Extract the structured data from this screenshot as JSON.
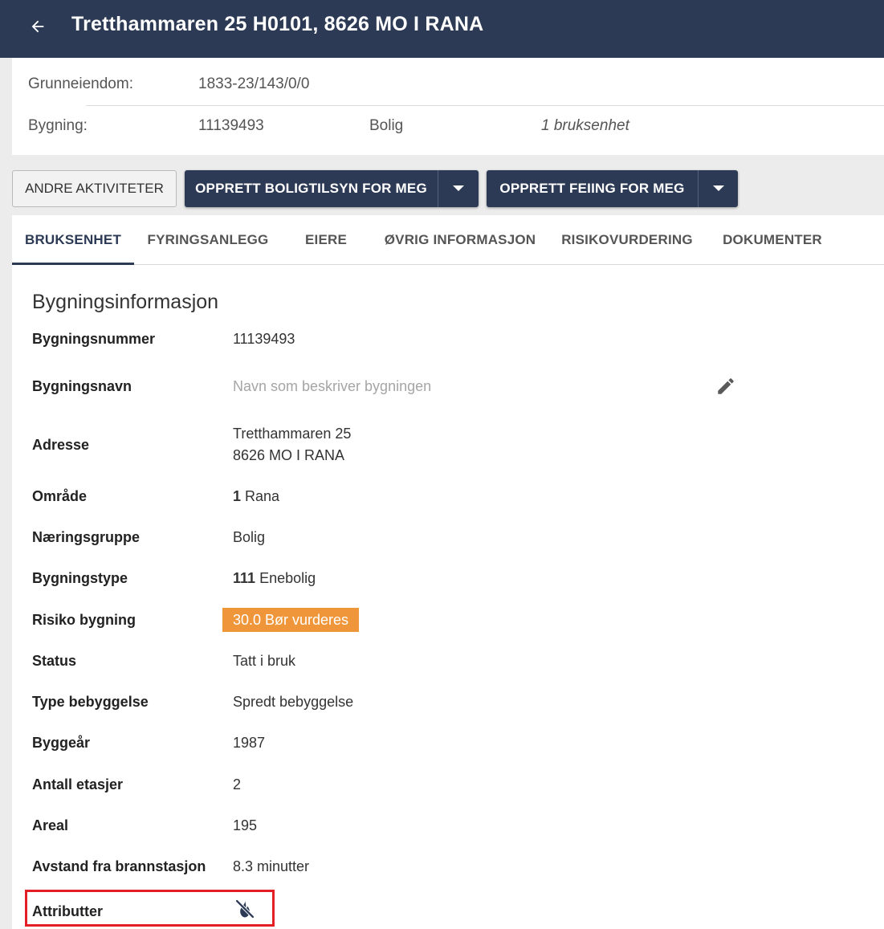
{
  "header": {
    "title": "Tretthammaren 25 H0101, 8626 MO I RANA",
    "back_icon": "arrow-left-icon"
  },
  "property": {
    "grunneiendom_label": "Grunneiendom:",
    "grunneiendom_value": "1833-23/143/0/0",
    "bygning_label": "Bygning:",
    "bygning_number": "11139493",
    "bygning_type": "Bolig",
    "bygning_units": "1 bruksenhet"
  },
  "actions": {
    "other_activities": "ANDRE AKTIVITETER",
    "create_inspection": "OPPRETT BOLIGTILSYN FOR MEG",
    "create_sweeping": "OPPRETT FEIING FOR MEG"
  },
  "tabs": [
    {
      "label": "BRUKSENHET",
      "active": true
    },
    {
      "label": "FYRINGSANLEGG",
      "active": false
    },
    {
      "label": "EIERE",
      "active": false
    },
    {
      "label": "ØVRIG INFORMASJON",
      "active": false
    },
    {
      "label": "RISIKOVURDERING",
      "active": false
    },
    {
      "label": "DOKUMENTER",
      "active": false
    }
  ],
  "building_info": {
    "title": "Bygningsinformasjon",
    "rows": {
      "bygningsnummer": {
        "label": "Bygningsnummer",
        "value": "11139493"
      },
      "bygningsnavn": {
        "label": "Bygningsnavn",
        "placeholder": "Navn som beskriver bygningen"
      },
      "adresse": {
        "label": "Adresse",
        "line1": "Tretthammaren 25",
        "line2": "8626 MO I RANA"
      },
      "omrade": {
        "label": "Område",
        "code": "1",
        "name": "Rana"
      },
      "naeringsgruppe": {
        "label": "Næringsgruppe",
        "value": "Bolig"
      },
      "bygningstype": {
        "label": "Bygningstype",
        "code": "111",
        "name": "Enebolig"
      },
      "risiko": {
        "label": "Risiko bygning",
        "value": "30.0 Bør vurderes"
      },
      "status": {
        "label": "Status",
        "value": "Tatt i bruk"
      },
      "type_bebyggelse": {
        "label": "Type bebyggelse",
        "value": "Spredt bebyggelse"
      },
      "byggear": {
        "label": "Byggeår",
        "value": "1987"
      },
      "etasjer": {
        "label": "Antall etasjer",
        "value": "2"
      },
      "areal": {
        "label": "Areal",
        "value": "195"
      },
      "avstand": {
        "label": "Avstand fra brannstasjon",
        "value": "8.3 minutter"
      },
      "attributter": {
        "label": "Attributter",
        "icon": "fire-off-icon"
      }
    }
  },
  "colors": {
    "header_bg": "#2d3a55",
    "risk_badge": "#f0963a",
    "highlight": "#e31e24"
  }
}
